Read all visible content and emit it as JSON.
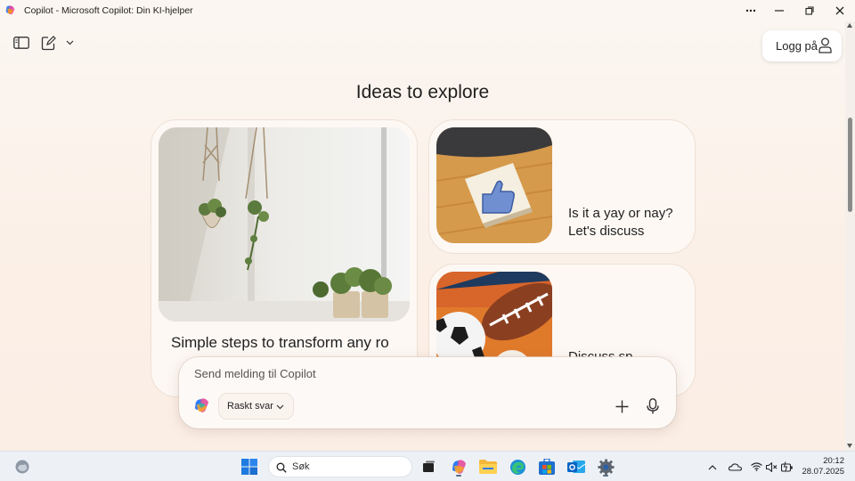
{
  "window": {
    "title": "Copilot - Microsoft Copilot: Din KI-hjelper",
    "controls": [
      "more-icon",
      "minimize-icon",
      "maximize-icon",
      "close-icon"
    ]
  },
  "toolbar": {
    "icons": [
      "sidebar-toggle-icon",
      "new-chat-icon",
      "chevron-down-icon"
    ],
    "login_label": "Logg på"
  },
  "main": {
    "heading": "Ideas to explore",
    "cards": [
      {
        "text": "Simple steps to transform any ro",
        "image": "hanging-plants"
      },
      {
        "text_line1": "Is it a yay or nay?",
        "text_line2": "Let's discuss",
        "image": "thumbs-up-note"
      },
      {
        "text": "Discuss sp",
        "image": "sports-balls"
      }
    ]
  },
  "composer": {
    "placeholder": "Send melding til Copilot",
    "mode_label": "Raskt svar",
    "icons": [
      "copilot-logo-icon",
      "plus-icon",
      "microphone-icon"
    ]
  },
  "taskbar": {
    "search_placeholder": "Søk",
    "apps": [
      "start-icon",
      "task-view-icon",
      "copilot-app-icon",
      "file-explorer-icon",
      "edge-icon",
      "store-icon",
      "outlook-icon",
      "settings-icon"
    ],
    "tray_icons": [
      "show-hidden-icon",
      "onedrive-icon",
      "wifi-icon",
      "volume-muted-icon",
      "battery-icon"
    ],
    "time": "20:12",
    "date": "28.07.2025"
  },
  "colors": {
    "background": "#fbf3ec",
    "card": "#fdf8f4",
    "taskbar": "#edf1f6",
    "accent_blue": "#0067c0"
  }
}
